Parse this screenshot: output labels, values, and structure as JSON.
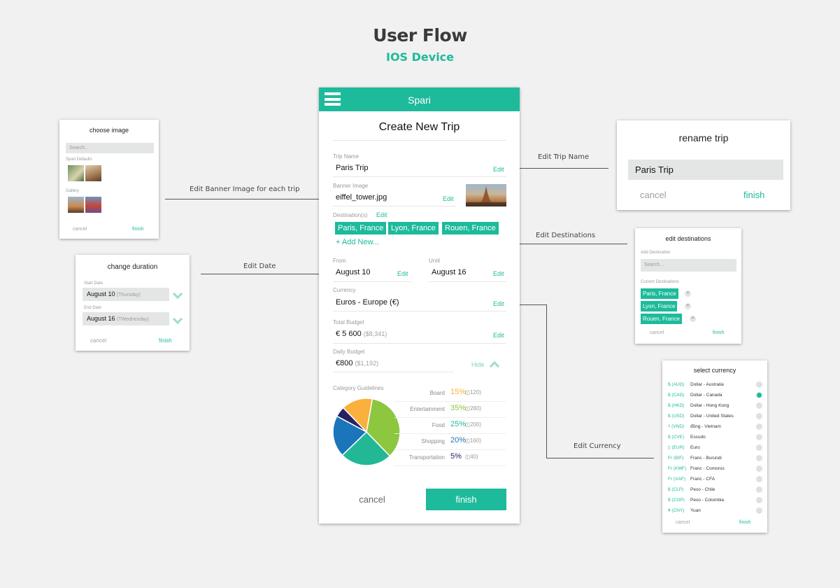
{
  "page": {
    "title": "User Flow",
    "subtitle": "IOS Device"
  },
  "colors": {
    "accent": "#1dba9b",
    "background": "#f1f1f1"
  },
  "main_screen": {
    "app_name": "Spari",
    "menu_icon": "hamburger-menu-icon",
    "screen_title": "Create New Trip",
    "trip_name": {
      "label": "Trip Name",
      "value": "Paris Trip",
      "edit": "Edit"
    },
    "banner_image": {
      "label": "Banner Image",
      "value": "eiffel_tower.jpg",
      "edit": "Edit",
      "thumbnail": "eiffel-tower-image"
    },
    "destinations": {
      "label": "Destination(s)",
      "edit": "Edit",
      "chips": [
        "Paris, France",
        "Lyon, France",
        "Rouen, France"
      ],
      "add_new": "+ Add New..."
    },
    "from": {
      "label": "From",
      "value": "August 10",
      "edit": "Edit"
    },
    "until": {
      "label": "Until",
      "value": "August 16",
      "edit": "Edit"
    },
    "currency": {
      "label": "Currency",
      "value": "Euros - Europe (€)",
      "edit": "Edit"
    },
    "total_budget": {
      "label": "Total Budget",
      "value": "€ 5 600",
      "converted": "($8,341)",
      "edit": "Edit"
    },
    "daily_budget": {
      "label": "Daily Budget",
      "value": "€800",
      "converted": "($1,192)",
      "hide": "Hide"
    },
    "category_guidelines": {
      "label": "Category Guidelines",
      "categories": [
        {
          "name": "Board",
          "percent": "15%",
          "amount": "(▯120)",
          "color": "#f9b03c"
        },
        {
          "name": "Entertainment",
          "percent": "35%",
          "amount": "(▯280)",
          "color": "#8dc63f"
        },
        {
          "name": "Food",
          "percent": "25%",
          "amount": "(▯200)",
          "color": "#22b896"
        },
        {
          "name": "Shopping",
          "percent": "20%",
          "amount": "(▯160)",
          "color": "#1b75bb"
        },
        {
          "name": "Transportation",
          "percent": "5%",
          "amount": "(▯40)",
          "color": "#262262"
        }
      ]
    },
    "cancel": "cancel",
    "finish": "finish"
  },
  "chart_data": {
    "type": "pie",
    "title": "Category Guidelines",
    "categories": [
      "Entertainment",
      "Food",
      "Shopping",
      "Transportation",
      "Board"
    ],
    "values": [
      35,
      25,
      20,
      5,
      15
    ],
    "colors": [
      "#8dc63f",
      "#22b896",
      "#1b75bb",
      "#262262",
      "#f9b03c"
    ]
  },
  "connectors": {
    "banner": "Edit Banner Image for each trip",
    "date": "Edit Date",
    "trip_name": "Edit Trip Name",
    "destinations": "Edit Destinations",
    "currency": "Edit Currency"
  },
  "choose_image": {
    "title": "choose image",
    "search_placeholder": "Search...",
    "defaults_label": "Spari Defaults",
    "gallery_label": "Gallery",
    "cancel": "cancel",
    "finish": "finish"
  },
  "change_duration": {
    "title": "change duration",
    "start_label": "Start Date",
    "start_value": "August 10",
    "start_day": "(Thursday)",
    "end_label": "End Date",
    "end_value": "August 16",
    "end_day": "(TWednesday)",
    "cancel": "cancel",
    "finish": "finish"
  },
  "rename_trip": {
    "title": "rename trip",
    "value": "Paris Trip",
    "cancel": "cancel",
    "finish": "finish"
  },
  "edit_destinations": {
    "title": "edit destinations",
    "add_label": "Add Destination",
    "search_placeholder": "Search...",
    "current_label": "Current Destinations",
    "chips": [
      "Paris, France",
      "Lyon, France",
      "Rouen, France"
    ],
    "remove_icon": "×",
    "cancel": "cancel",
    "finish": "finish"
  },
  "select_currency": {
    "title": "select currency",
    "selected_index": 1,
    "options": [
      {
        "code": "$ (AUD)",
        "name": "Dollar - Australia"
      },
      {
        "code": "$ (CAD)",
        "name": "Dollar - Canada"
      },
      {
        "code": "$ (HKD)",
        "name": "Dollar - Hong Kong"
      },
      {
        "code": "$ (USD)",
        "name": "Dollar - United States"
      },
      {
        "code": "₫ (VND)",
        "name": "đồng - Vietnam"
      },
      {
        "code": "$ (CVE)",
        "name": "Escudo"
      },
      {
        "code": "▯ (EUR)",
        "name": "Euro"
      },
      {
        "code": "Fr (BIF)",
        "name": "Franc - Burundi"
      },
      {
        "code": "Fr (KMF)",
        "name": "Franc - Comoros"
      },
      {
        "code": "Fr (XAF)",
        "name": "Franc - CFA"
      },
      {
        "code": "$ (CLP)",
        "name": "Peso - Chile"
      },
      {
        "code": "$ (COP)",
        "name": "Peso - Colombia"
      },
      {
        "code": "¥ (CNY)",
        "name": "Yuan"
      }
    ],
    "cancel": "cancel",
    "finish": "finish"
  }
}
